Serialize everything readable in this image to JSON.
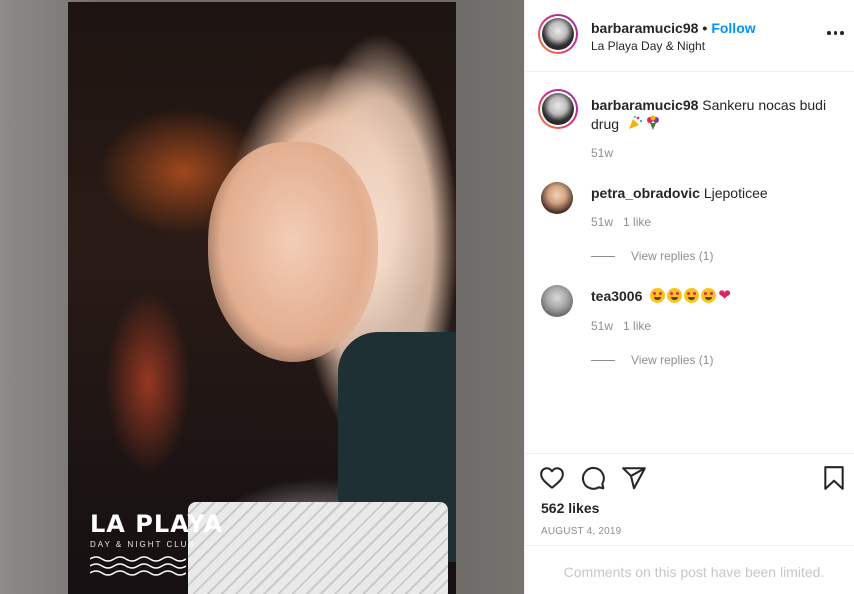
{
  "post": {
    "username": "barbaramucic98",
    "follow_label": "Follow",
    "separator": "•",
    "location": "La Playa Day & Night",
    "photo_logo": {
      "main": "LA PLAYA",
      "sub": "DAY & NIGHT CLUB"
    }
  },
  "caption": {
    "username": "barbaramucic98",
    "text": "Sankeru nocas budi drug",
    "emojis": [
      "party-popper-emoji",
      "bouquet-emoji"
    ],
    "time": "51w"
  },
  "comments": [
    {
      "username": "petra_obradovic",
      "text": "Ljepoticee",
      "time": "51w",
      "likes": "1 like",
      "replies": "View replies (1)"
    },
    {
      "username": "tea3006",
      "text": "",
      "emojis": [
        "star-struck-emoji",
        "star-struck-emoji",
        "star-struck-emoji",
        "star-struck-emoji",
        "red-heart-emoji"
      ],
      "time": "51w",
      "likes": "1 like",
      "replies": "View replies (1)"
    }
  ],
  "actions": {
    "likes": "562 likes",
    "date": "AUGUST 4, 2019",
    "icons": [
      "heart-outline-icon",
      "comment-icon",
      "share-icon",
      "bookmark-icon"
    ]
  },
  "footer": {
    "limited_text": "Comments on this post have been limited."
  },
  "colors": {
    "follow": "#0095f6",
    "muted": "#8e8e8e",
    "limited": "#c7c7c7",
    "heart": "#e0245e"
  }
}
